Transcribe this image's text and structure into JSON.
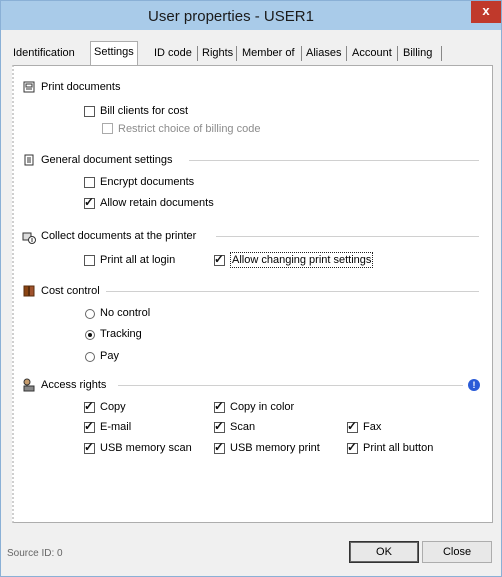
{
  "window": {
    "title": "User properties - USER1",
    "close_glyph": "x"
  },
  "tabs": [
    "Identification",
    "Settings",
    "ID code",
    "Rights",
    "Member of",
    "Aliases",
    "Account",
    "Billing"
  ],
  "sections": {
    "print": {
      "title": "Print documents",
      "icon": "printer-icon",
      "bill_clients": {
        "label": "Bill clients for cost",
        "checked": false
      },
      "restrict_billing": {
        "label": "Restrict choice of billing code",
        "checked": false,
        "enabled": false
      }
    },
    "general": {
      "title": "General document settings",
      "icon": "document-icon",
      "encrypt": {
        "label": "Encrypt documents",
        "checked": false
      },
      "allow_retain": {
        "label": "Allow retain documents",
        "checked": true
      }
    },
    "collect": {
      "title": "Collect documents at the printer",
      "icon": "collect-printer-icon",
      "print_all_login": {
        "label": "Print all at login",
        "checked": false
      },
      "allow_changing": {
        "label": "Allow changing print settings",
        "checked": true
      }
    },
    "cost": {
      "title": "Cost control",
      "icon": "book-icon",
      "options": [
        {
          "label": "No control",
          "selected": false
        },
        {
          "label": "Tracking",
          "selected": true
        },
        {
          "label": "Pay",
          "selected": false
        }
      ]
    },
    "access": {
      "title": "Access rights",
      "icon": "lock-user-icon",
      "info_icon": "info-icon",
      "copy": {
        "label": "Copy",
        "checked": true
      },
      "copy_color": {
        "label": "Copy in color",
        "checked": true
      },
      "email": {
        "label": "E-mail",
        "checked": true
      },
      "scan": {
        "label": "Scan",
        "checked": true
      },
      "fax": {
        "label": "Fax",
        "checked": true
      },
      "usb_scan": {
        "label": "USB memory scan",
        "checked": true
      },
      "usb_print": {
        "label": "USB memory print",
        "checked": true
      },
      "print_all_button": {
        "label": "Print all button",
        "checked": true
      }
    }
  },
  "footer": {
    "source_id": "Source ID: 0",
    "ok_label": "OK",
    "close_label": "Close"
  },
  "colors": {
    "titlebar": "#a9cbe9",
    "close": "#c0392b",
    "info": "#2a5bd7"
  }
}
